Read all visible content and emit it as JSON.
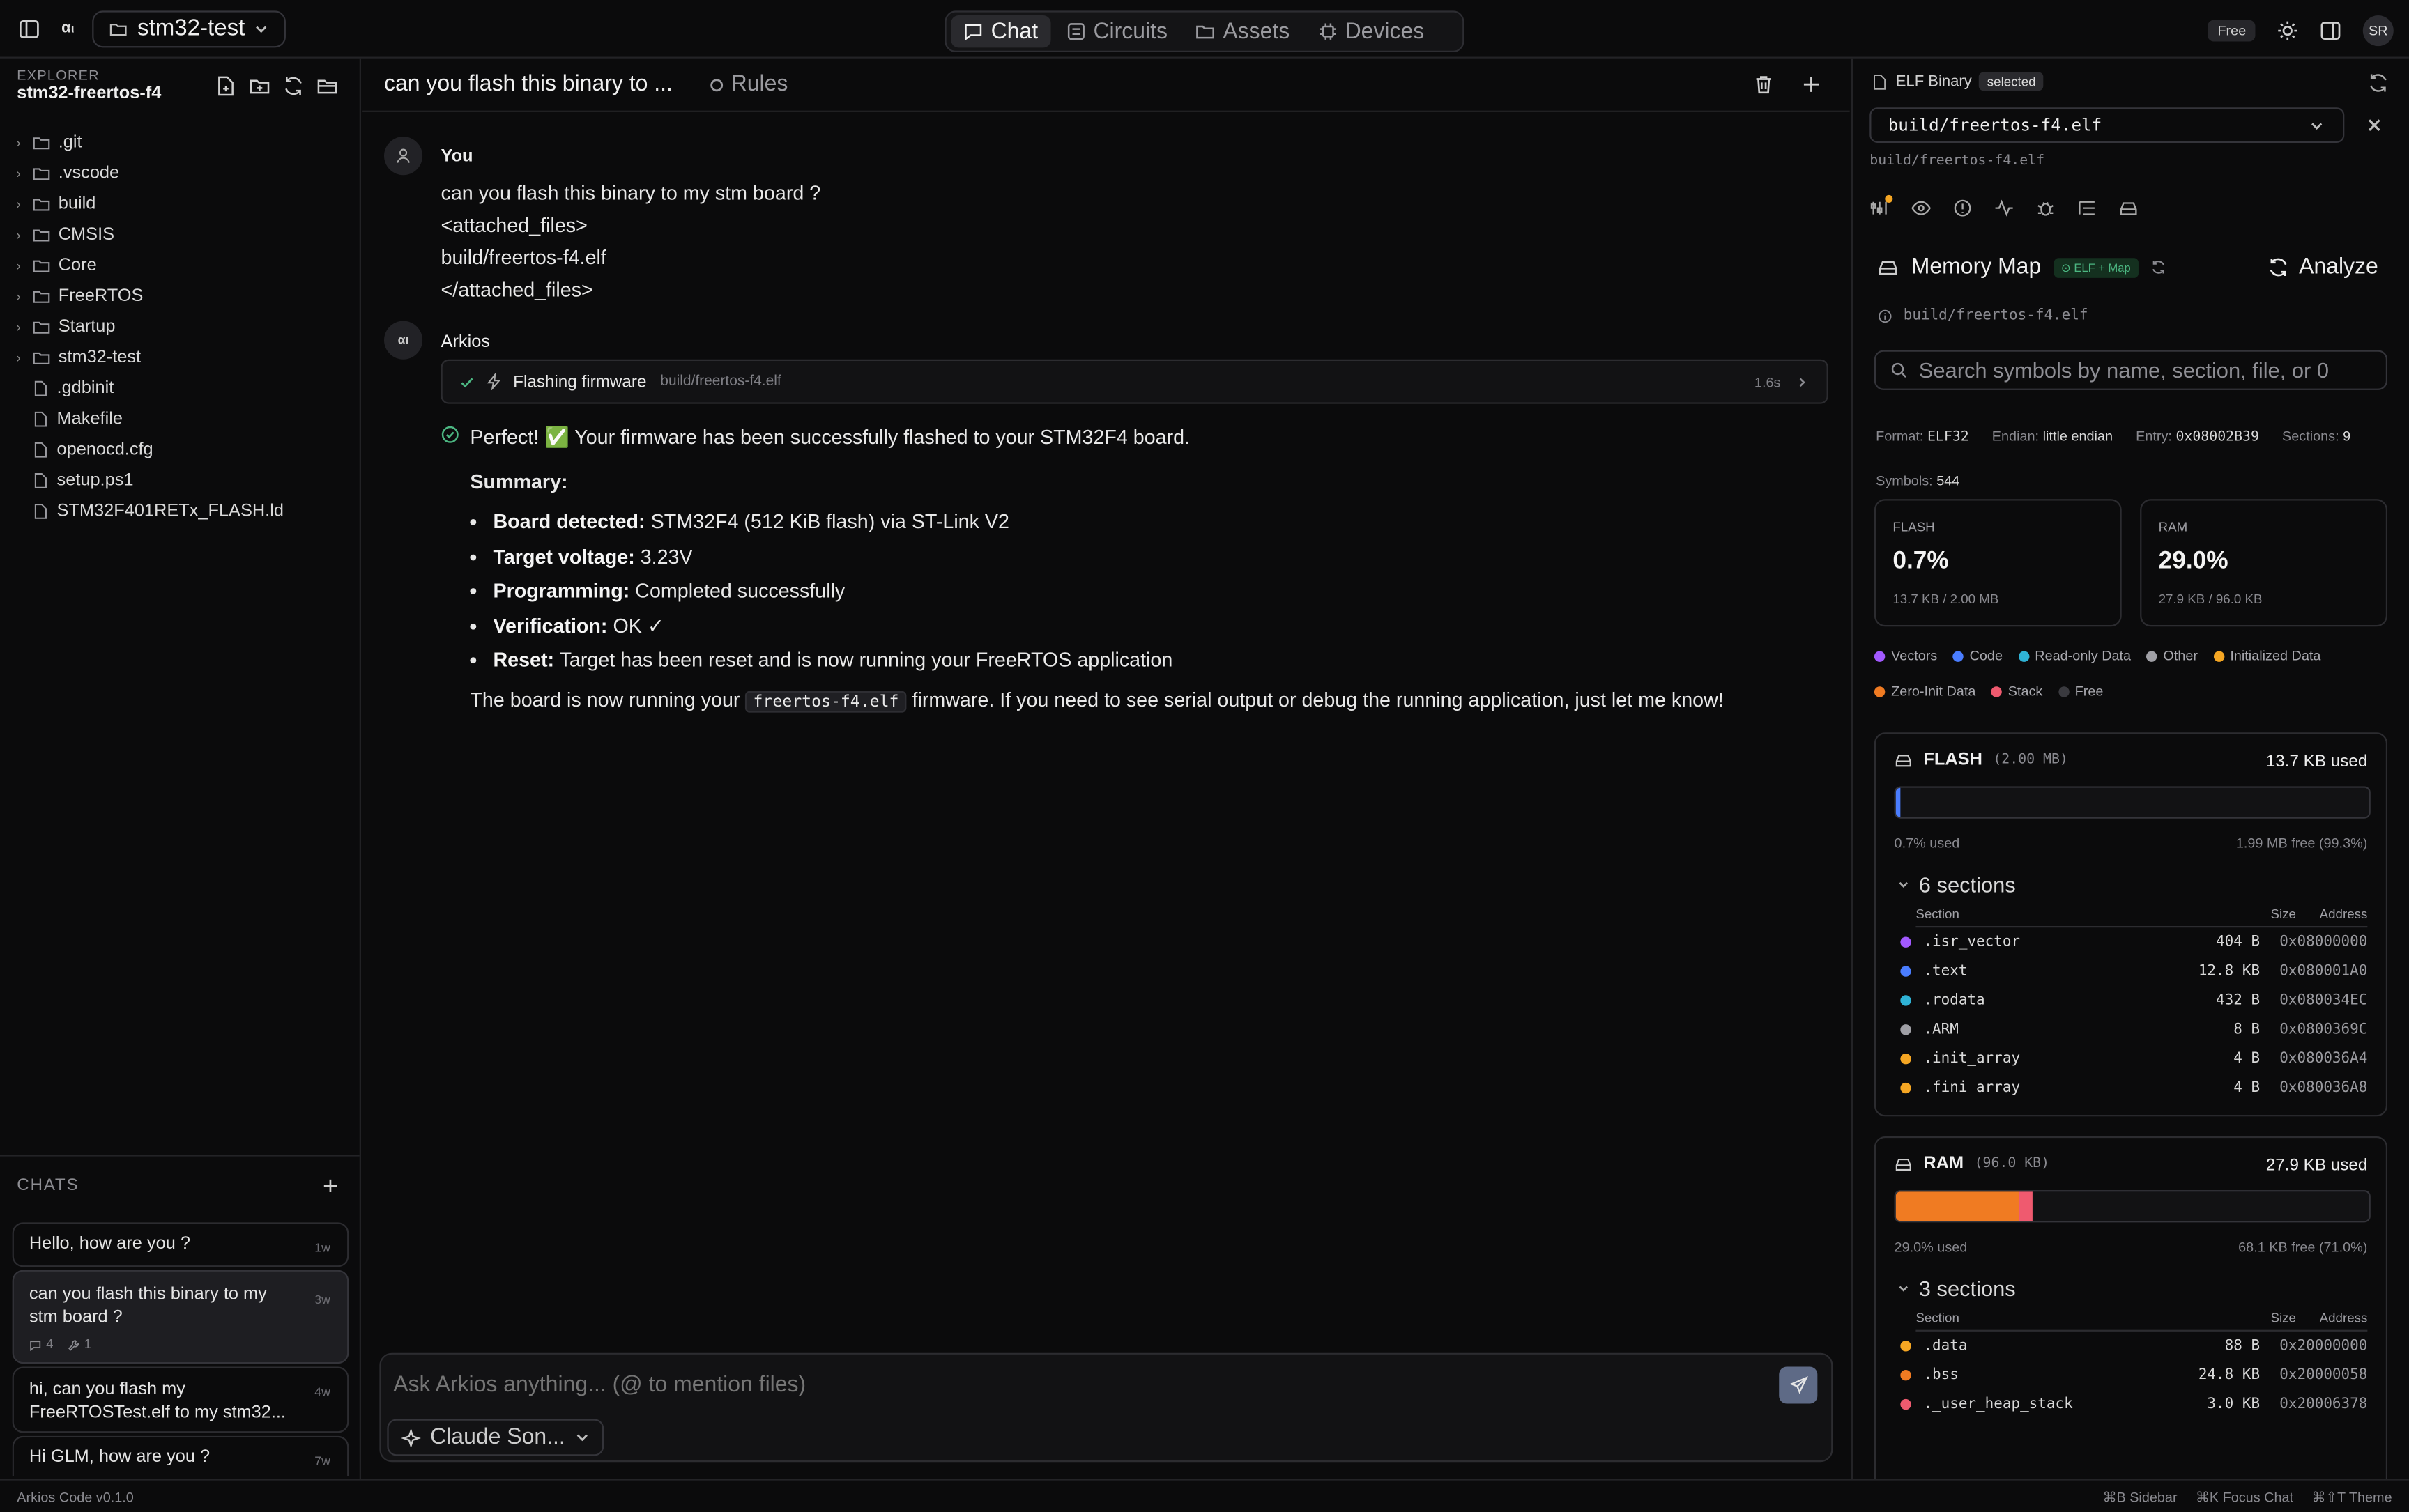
{
  "topbar": {
    "project": "stm32-test",
    "tabs": [
      {
        "label": "Chat",
        "icon": "chat-icon",
        "active": true
      },
      {
        "label": "Circuits",
        "icon": "circuit-icon",
        "active": false
      },
      {
        "label": "Assets",
        "icon": "folder-icon",
        "active": false
      },
      {
        "label": "Devices",
        "icon": "chip-icon",
        "active": false
      }
    ],
    "plan_badge": "Free",
    "avatar_initials": "SR"
  },
  "explorer": {
    "label": "EXPLORER",
    "folder": "stm32-freertos-f4",
    "items": [
      {
        "name": ".git",
        "type": "folder"
      },
      {
        "name": ".vscode",
        "type": "folder"
      },
      {
        "name": "build",
        "type": "folder"
      },
      {
        "name": "CMSIS",
        "type": "folder"
      },
      {
        "name": "Core",
        "type": "folder"
      },
      {
        "name": "FreeRTOS",
        "type": "folder"
      },
      {
        "name": "Startup",
        "type": "folder"
      },
      {
        "name": "stm32-test",
        "type": "folder"
      },
      {
        "name": ".gdbinit",
        "type": "file"
      },
      {
        "name": "Makefile",
        "type": "file"
      },
      {
        "name": "openocd.cfg",
        "type": "file"
      },
      {
        "name": "setup.ps1",
        "type": "file"
      },
      {
        "name": "STM32F401RETx_FLASH.ld",
        "type": "file"
      }
    ]
  },
  "chats": {
    "label": "CHATS",
    "items": [
      {
        "title": "Hello, how are you ?",
        "age": "1w"
      },
      {
        "title": "can you flash this binary to my stm board ?",
        "age": "3w",
        "messages": "4",
        "tools": "1"
      },
      {
        "title": "hi, can you flash my FreeRTOSTest.elf to my stm32...",
        "age": "4w"
      },
      {
        "title": "Hi GLM, how are you ?",
        "age": "7w"
      }
    ]
  },
  "main": {
    "title": "can you flash this binary to ...",
    "rules_label": "Rules",
    "user": {
      "name": "You",
      "lines": [
        "can you flash this binary to my stm board ?",
        "<attached_files>",
        "build/freertos-f4.elf",
        "</attached_files>"
      ]
    },
    "assistant": {
      "name": "Arkios",
      "tool": {
        "label": "Flashing firmware",
        "path": "build/freertos-f4.elf",
        "duration": "1.6s"
      },
      "intro": "Perfect! ✅ Your firmware has been successfully flashed to your STM32F4 board.",
      "summary_label": "Summary:",
      "bullets": [
        {
          "k": "Board detected:",
          "v": "STM32F4 (512 KiB flash) via ST-Link V2"
        },
        {
          "k": "Target voltage:",
          "v": "3.23V"
        },
        {
          "k": "Programming:",
          "v": "Completed successfully"
        },
        {
          "k": "Verification:",
          "v": "OK ✓"
        },
        {
          "k": "Reset:",
          "v": "Target has been reset and is now running your FreeRTOS application"
        }
      ],
      "outro_pre": "The board is now running your",
      "outro_code": "freertos-f4.elf",
      "outro_post": "firmware. If you need to see serial output or debug the running application, just let me know!"
    },
    "composer": {
      "placeholder": "Ask Arkios anything... (@ to mention files)",
      "model": "Claude Son..."
    }
  },
  "panel": {
    "kind": "ELF Binary",
    "badge": "selected",
    "file": "build/freertos-f4.elf",
    "sub": "build/freertos-f4.elf",
    "title": "Memory Map",
    "title_badge": "ELF + Map",
    "analyze": "Analyze",
    "path": "build/freertos-f4.elf",
    "search_placeholder": "Search symbols by name, section, file, or 0",
    "meta": {
      "format_label": "Format:",
      "format": "ELF32",
      "endian_label": "Endian:",
      "endian": "little endian",
      "entry_label": "Entry:",
      "entry": "0x08002B39",
      "sections_label": "Sections:",
      "sections": "9",
      "symbols_label": "Symbols:",
      "symbols": "544"
    },
    "cards": [
      {
        "label": "FLASH",
        "pct": "0.7%",
        "size": "13.7 KB / 2.00 MB"
      },
      {
        "label": "RAM",
        "pct": "29.0%",
        "size": "27.9 KB / 96.0 KB"
      }
    ],
    "legend": [
      {
        "label": "Vectors",
        "color": "#a259ff"
      },
      {
        "label": "Code",
        "color": "#4a7dff"
      },
      {
        "label": "Read-only Data",
        "color": "#2fb3d6"
      },
      {
        "label": "Other",
        "color": "#a0a0a6"
      },
      {
        "label": "Initialized Data",
        "color": "#f5a623"
      },
      {
        "label": "Zero-Init Data",
        "color": "#f07b22"
      },
      {
        "label": "Stack",
        "color": "#ef5a6f"
      },
      {
        "label": "Free",
        "color": "#3a3a3f"
      }
    ],
    "flash": {
      "name": "FLASH",
      "capacity": "(2.00 MB)",
      "used": "13.7 KB used",
      "used_pct": "0.7% used",
      "free": "1.99 MB free (99.3%)",
      "fill": 0.007,
      "sections_label": "6 sections",
      "col_section": "Section",
      "col_size": "Size",
      "col_address": "Address",
      "rows": [
        {
          "name": ".isr_vector",
          "size": "404 B",
          "addr": "0x08000000",
          "color": "#a259ff"
        },
        {
          "name": ".text",
          "size": "12.8 KB",
          "addr": "0x080001A0",
          "color": "#4a7dff"
        },
        {
          "name": ".rodata",
          "size": "432 B",
          "addr": "0x080034EC",
          "color": "#2fb3d6"
        },
        {
          "name": ".ARM",
          "size": "8 B",
          "addr": "0x0800369C",
          "color": "#a0a0a6"
        },
        {
          "name": ".init_array",
          "size": "4 B",
          "addr": "0x080036A4",
          "color": "#f5a623"
        },
        {
          "name": ".fini_array",
          "size": "4 B",
          "addr": "0x080036A8",
          "color": "#f5a623"
        }
      ]
    },
    "ram": {
      "name": "RAM",
      "capacity": "(96.0 KB)",
      "used": "27.9 KB used",
      "used_pct": "29.0% used",
      "free": "68.1 KB free (71.0%)",
      "fill": 0.29,
      "stack_fill": 0.031,
      "data_fill": 0.009,
      "sections_label": "3 sections",
      "col_section": "Section",
      "col_size": "Size",
      "col_address": "Address",
      "rows": [
        {
          "name": ".data",
          "size": "88 B",
          "addr": "0x20000000",
          "color": "#f5a623"
        },
        {
          "name": ".bss",
          "size": "24.8 KB",
          "addr": "0x20000058",
          "color": "#f07b22"
        },
        {
          "name": "._user_heap_stack",
          "size": "3.0 KB",
          "addr": "0x20006378",
          "color": "#ef5a6f"
        }
      ]
    }
  },
  "status": {
    "version": "Arkios Code v0.1.0",
    "shortcuts": [
      "⌘B Sidebar",
      "⌘K Focus Chat",
      "⌘⇧T Theme"
    ]
  }
}
